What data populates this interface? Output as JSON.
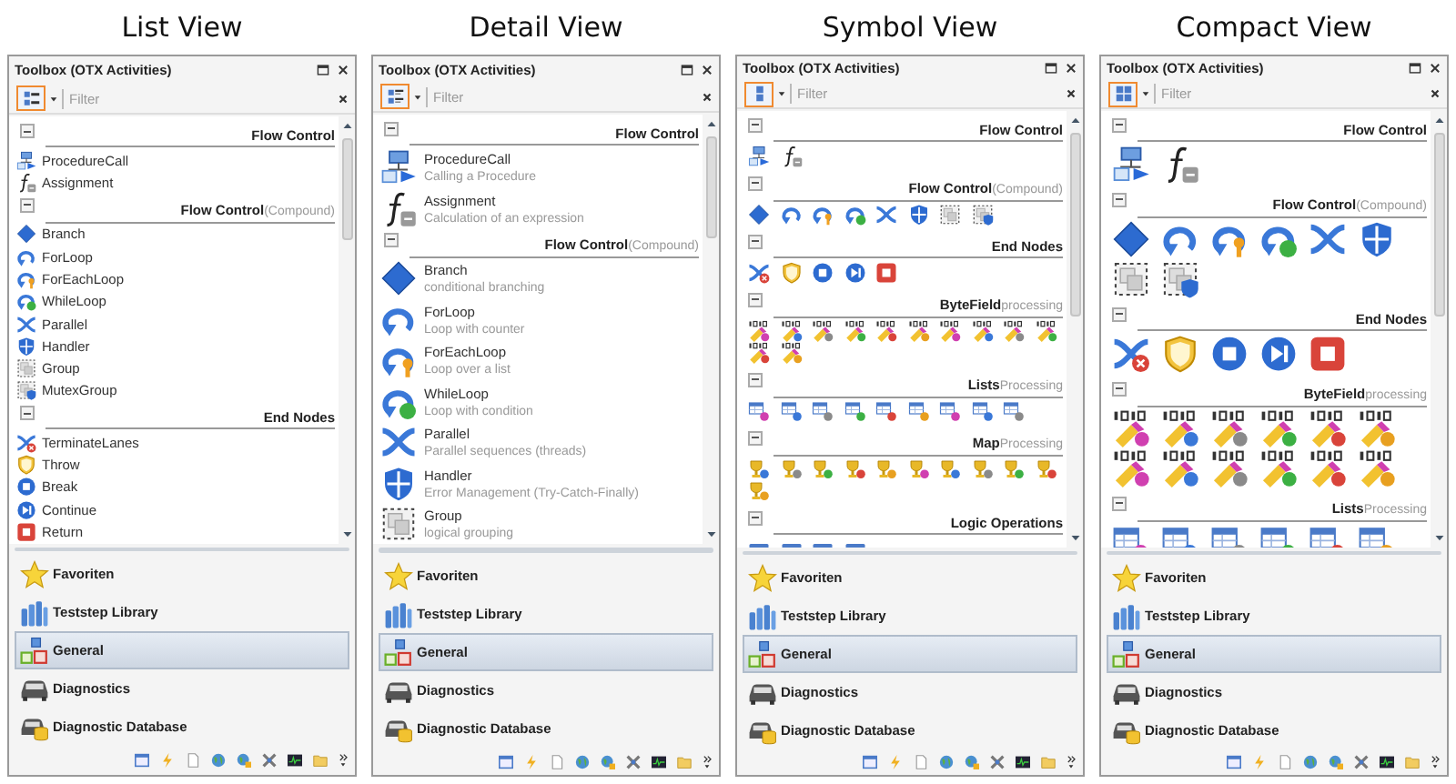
{
  "panels": [
    {
      "caption": "List View",
      "kind": "list",
      "title": "Toolbox (OTX Activities)",
      "filter_placeholder": "Filter",
      "groups": [
        {
          "title": "Flow Control",
          "expanded": true,
          "items": [
            {
              "kind": "procedure",
              "label": "ProcedureCall"
            },
            {
              "kind": "function",
              "label": "Assignment"
            }
          ]
        },
        {
          "title": "Flow Control",
          "note": "(Compound)",
          "expanded": true,
          "items": [
            {
              "kind": "diamond",
              "label": "Branch"
            },
            {
              "kind": "loop",
              "label": "ForLoop"
            },
            {
              "kind": "loop-key",
              "label": "ForEachLoop"
            },
            {
              "kind": "loop-check",
              "label": "WhileLoop"
            },
            {
              "kind": "parallel",
              "label": "Parallel"
            },
            {
              "kind": "shield",
              "label": "Handler"
            },
            {
              "kind": "group",
              "label": "Group"
            },
            {
              "kind": "group-shield",
              "label": "MutexGroup"
            }
          ]
        },
        {
          "title": "End Nodes",
          "expanded": true,
          "items": [
            {
              "kind": "terminate",
              "label": "TerminateLanes"
            },
            {
              "kind": "throw",
              "label": "Throw"
            },
            {
              "kind": "stop",
              "label": "Break"
            },
            {
              "kind": "skip",
              "label": "Continue"
            },
            {
              "kind": "return",
              "label": "Return"
            }
          ]
        }
      ],
      "categories": [
        {
          "kind": "star",
          "label": "Favoriten",
          "selected": false
        },
        {
          "kind": "books",
          "label": "Teststep Library",
          "selected": false
        },
        {
          "kind": "blocks",
          "label": "General",
          "selected": true
        },
        {
          "kind": "car",
          "label": "Diagnostics",
          "selected": false
        },
        {
          "kind": "car-db",
          "label": "Diagnostic Database",
          "selected": false
        }
      ]
    },
    {
      "caption": "Detail View",
      "kind": "detail",
      "title": "Toolbox (OTX Activities)",
      "filter_placeholder": "Filter",
      "groups": [
        {
          "title": "Flow Control",
          "expanded": true,
          "items": [
            {
              "kind": "procedure",
              "label": "ProcedureCall",
              "description": "Calling a Procedure"
            },
            {
              "kind": "function",
              "label": "Assignment",
              "description": "Calculation of an expression"
            }
          ]
        },
        {
          "title": "Flow Control",
          "note": "(Compound)",
          "expanded": true,
          "items": [
            {
              "kind": "diamond",
              "label": "Branch",
              "description": "conditional branching"
            },
            {
              "kind": "loop",
              "label": "ForLoop",
              "description": "Loop with counter"
            },
            {
              "kind": "loop-key",
              "label": "ForEachLoop",
              "description": "Loop over a list"
            },
            {
              "kind": "loop-check",
              "label": "WhileLoop",
              "description": "Loop with condition"
            },
            {
              "kind": "parallel",
              "label": "Parallel",
              "description": "Parallel sequences (threads)"
            },
            {
              "kind": "shield",
              "label": "Handler",
              "description": "Error Management (Try-Catch-Finally)"
            },
            {
              "kind": "group",
              "label": "Group",
              "description": "logical grouping"
            }
          ]
        }
      ],
      "categories": [
        {
          "kind": "star",
          "label": "Favoriten",
          "selected": false
        },
        {
          "kind": "books",
          "label": "Teststep Library",
          "selected": false
        },
        {
          "kind": "blocks",
          "label": "General",
          "selected": true
        },
        {
          "kind": "car",
          "label": "Diagnostics",
          "selected": false
        },
        {
          "kind": "car-db",
          "label": "Diagnostic Database",
          "selected": false
        }
      ]
    },
    {
      "caption": "Symbol View",
      "kind": "symbol",
      "title": "Toolbox (OTX Activities)",
      "filter_placeholder": "Filter",
      "groups": [
        {
          "title": "Flow Control",
          "expanded": true,
          "items": [
            {
              "kind": "procedure"
            },
            {
              "kind": "function"
            }
          ]
        },
        {
          "title": "Flow Control",
          "note": "(Compound)",
          "expanded": true,
          "items": [
            {
              "kind": "diamond"
            },
            {
              "kind": "loop"
            },
            {
              "kind": "loop-key"
            },
            {
              "kind": "loop-check"
            },
            {
              "kind": "parallel"
            },
            {
              "kind": "shield"
            },
            {
              "kind": "group"
            },
            {
              "kind": "group-shield"
            }
          ]
        },
        {
          "title": "End Nodes",
          "expanded": true,
          "items": [
            {
              "kind": "terminate"
            },
            {
              "kind": "throw"
            },
            {
              "kind": "stop"
            },
            {
              "kind": "skip"
            },
            {
              "kind": "return"
            }
          ]
        },
        {
          "title": "ByteField",
          "note": "processing",
          "expanded": true,
          "items": [
            {
              "kind": "bytefield"
            },
            {
              "kind": "bytefield"
            },
            {
              "kind": "bytefield"
            },
            {
              "kind": "bytefield"
            },
            {
              "kind": "bytefield"
            },
            {
              "kind": "bytefield"
            },
            {
              "kind": "bytefield"
            },
            {
              "kind": "bytefield"
            },
            {
              "kind": "bytefield"
            },
            {
              "kind": "bytefield"
            },
            {
              "kind": "bytefield"
            },
            {
              "kind": "bytefield"
            }
          ]
        },
        {
          "title": "Lists",
          "note": "Processing",
          "expanded": true,
          "items": [
            {
              "kind": "list"
            },
            {
              "kind": "list"
            },
            {
              "kind": "list"
            },
            {
              "kind": "list"
            },
            {
              "kind": "list"
            },
            {
              "kind": "list"
            },
            {
              "kind": "list"
            },
            {
              "kind": "list"
            },
            {
              "kind": "list"
            }
          ]
        },
        {
          "title": "Map",
          "note": "Processing",
          "expanded": true,
          "items": [
            {
              "kind": "map"
            },
            {
              "kind": "map"
            },
            {
              "kind": "map"
            },
            {
              "kind": "map"
            },
            {
              "kind": "map"
            },
            {
              "kind": "map"
            },
            {
              "kind": "map"
            },
            {
              "kind": "map"
            },
            {
              "kind": "map"
            },
            {
              "kind": "map"
            },
            {
              "kind": "map"
            }
          ]
        },
        {
          "title": "Logic Operations",
          "expanded": true,
          "items": [
            {
              "kind": "logic"
            },
            {
              "kind": "logic"
            },
            {
              "kind": "logic"
            },
            {
              "kind": "logic"
            }
          ]
        }
      ],
      "categories": [
        {
          "kind": "star",
          "label": "Favoriten",
          "selected": false
        },
        {
          "kind": "books",
          "label": "Teststep Library",
          "selected": false
        },
        {
          "kind": "blocks",
          "label": "General",
          "selected": true
        },
        {
          "kind": "car",
          "label": "Diagnostics",
          "selected": false
        },
        {
          "kind": "car-db",
          "label": "Diagnostic Database",
          "selected": false
        }
      ]
    },
    {
      "caption": "Compact View",
      "kind": "compact",
      "title": "Toolbox (OTX Activities)",
      "filter_placeholder": "Filter",
      "groups": [
        {
          "title": "Flow Control",
          "expanded": true,
          "items": [
            {
              "kind": "procedure"
            },
            {
              "kind": "function"
            }
          ]
        },
        {
          "title": "Flow Control",
          "note": "(Compound)",
          "expanded": true,
          "items": [
            {
              "kind": "diamond"
            },
            {
              "kind": "loop"
            },
            {
              "kind": "loop-key"
            },
            {
              "kind": "loop-check"
            },
            {
              "kind": "parallel"
            },
            {
              "kind": "shield"
            },
            {
              "kind": "group"
            },
            {
              "kind": "group-shield"
            }
          ]
        },
        {
          "title": "End Nodes",
          "expanded": true,
          "items": [
            {
              "kind": "terminate"
            },
            {
              "kind": "throw"
            },
            {
              "kind": "stop"
            },
            {
              "kind": "skip"
            },
            {
              "kind": "return"
            }
          ]
        },
        {
          "title": "ByteField",
          "note": "processing",
          "expanded": true,
          "items": [
            {
              "kind": "bytefield"
            },
            {
              "kind": "bytefield"
            },
            {
              "kind": "bytefield"
            },
            {
              "kind": "bytefield"
            },
            {
              "kind": "bytefield"
            },
            {
              "kind": "bytefield"
            },
            {
              "kind": "bytefield"
            },
            {
              "kind": "bytefield"
            },
            {
              "kind": "bytefield"
            },
            {
              "kind": "bytefield"
            },
            {
              "kind": "bytefield"
            },
            {
              "kind": "bytefield"
            }
          ]
        },
        {
          "title": "Lists",
          "note": "Processing",
          "expanded": true,
          "items": [
            {
              "kind": "list"
            },
            {
              "kind": "list"
            },
            {
              "kind": "list"
            },
            {
              "kind": "list"
            },
            {
              "kind": "list"
            },
            {
              "kind": "list"
            }
          ]
        }
      ],
      "categories": [
        {
          "kind": "star",
          "label": "Favoriten",
          "selected": false
        },
        {
          "kind": "books",
          "label": "Teststep Library",
          "selected": false
        },
        {
          "kind": "blocks",
          "label": "General",
          "selected": true
        },
        {
          "kind": "car",
          "label": "Diagnostics",
          "selected": false
        },
        {
          "kind": "car-db",
          "label": "Diagnostic Database",
          "selected": false
        }
      ]
    }
  ]
}
